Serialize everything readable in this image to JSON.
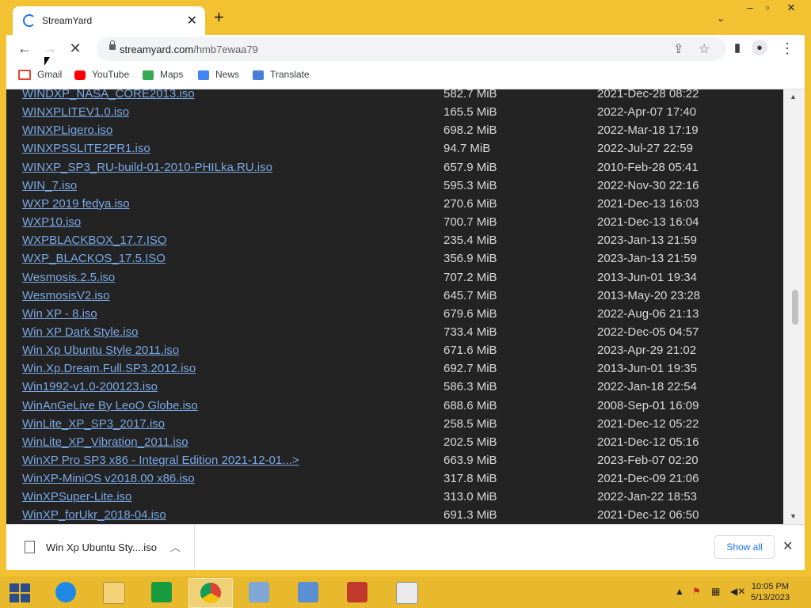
{
  "browser": {
    "tab_title": "StreamYard",
    "url_host": "streamyard.com",
    "url_path": "/hmb7ewaa79",
    "bookmarks": [
      "Gmail",
      "YouTube",
      "Maps",
      "News",
      "Translate"
    ]
  },
  "files": [
    {
      "name": "WINDXP_NASA_CORE2013.iso",
      "size": "582.7 MiB",
      "date": "2021-Dec-28 08:22"
    },
    {
      "name": "WINXPLITEV1.0.iso",
      "size": "165.5 MiB",
      "date": "2022-Apr-07 17:40"
    },
    {
      "name": "WINXPLigero.iso",
      "size": "698.2 MiB",
      "date": "2022-Mar-18 17:19"
    },
    {
      "name": "WINXPSSLITE2PR1.iso",
      "size": "94.7 MiB",
      "date": "2022-Jul-27 22:59"
    },
    {
      "name": "WINXP_SP3_RU-build-01-2010-PHILka.RU.iso",
      "size": "657.9 MiB",
      "date": "2010-Feb-28 05:41"
    },
    {
      "name": "WIN_7.iso",
      "size": "595.3 MiB",
      "date": "2022-Nov-30 22:16"
    },
    {
      "name": "WXP 2019 fedya.iso",
      "size": "270.6 MiB",
      "date": "2021-Dec-13 16:03"
    },
    {
      "name": "WXP10.iso",
      "size": "700.7 MiB",
      "date": "2021-Dec-13 16:04"
    },
    {
      "name": "WXPBLACKBOX_17.7.ISO",
      "size": "235.4 MiB",
      "date": "2023-Jan-13 21:59"
    },
    {
      "name": "WXP_BLACKOS_17.5.ISO",
      "size": "356.9 MiB",
      "date": "2023-Jan-13 21:59"
    },
    {
      "name": "Wesmosis.2.5.iso",
      "size": "707.2 MiB",
      "date": "2013-Jun-01 19:34"
    },
    {
      "name": "WesmosisV2.iso",
      "size": "645.7 MiB",
      "date": "2013-May-20 23:28"
    },
    {
      "name": "Win XP - 8.iso",
      "size": "679.6 MiB",
      "date": "2022-Aug-06 21:13"
    },
    {
      "name": "Win XP Dark Style.iso",
      "size": "733.4 MiB",
      "date": "2022-Dec-05 04:57"
    },
    {
      "name": "Win Xp Ubuntu Style 2011.iso",
      "size": "671.6 MiB",
      "date": "2023-Apr-29 21:02"
    },
    {
      "name": "Win.Xp.Dream.Full.SP3.2012.iso",
      "size": "692.7 MiB",
      "date": "2013-Jun-01 19:35"
    },
    {
      "name": "Win1992-v1.0-200123.iso",
      "size": "586.3 MiB",
      "date": "2022-Jan-18 22:54"
    },
    {
      "name": "WinAnGeLive By LeoO Globe.iso",
      "size": "688.6 MiB",
      "date": "2008-Sep-01 16:09"
    },
    {
      "name": "WinLite_XP_SP3_2017.iso",
      "size": "258.5 MiB",
      "date": "2021-Dec-12 05:22"
    },
    {
      "name": "WinLite_XP_Vibration_2011.iso",
      "size": "202.5 MiB",
      "date": "2021-Dec-12 05:16"
    },
    {
      "name": "WinXP Pro SP3 x86 - Integral Edition 2021-12-01...>",
      "size": "663.9 MiB",
      "date": "2023-Feb-07 02:20"
    },
    {
      "name": "WinXP-MiniOS v2018.00 x86.iso",
      "size": "317.8 MiB",
      "date": "2021-Dec-09 21:06"
    },
    {
      "name": "WinXPSuper-Lite.iso",
      "size": "313.0 MiB",
      "date": "2022-Jan-22 18:53"
    },
    {
      "name": "WinXP_forUkr_2018-04.iso",
      "size": "691.3 MiB",
      "date": "2021-Dec-12 06:50"
    }
  ],
  "download_shelf": {
    "item_name": "Win Xp Ubuntu Sty....iso",
    "show_all": "Show all"
  },
  "taskbar": {
    "time": "10:05 PM",
    "date": "5/13/2023"
  },
  "colors": {
    "frame": "#f2c233",
    "page_bg": "#232323",
    "link": "#7aa9e6"
  }
}
